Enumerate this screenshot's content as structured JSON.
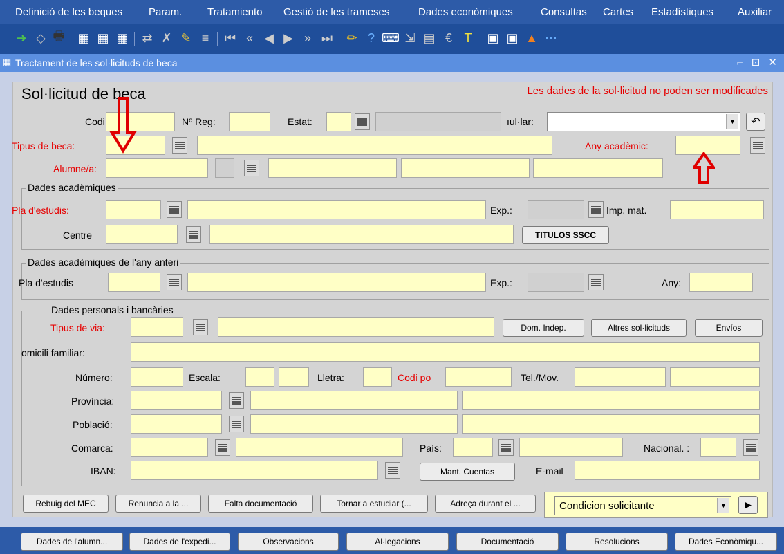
{
  "menu": [
    "Definició de les beques",
    "Param.",
    "Tratamiento",
    "Gestió de les trameses",
    "Dades econòmiques",
    "Consultas",
    "Cartes",
    "Estadístiques",
    "Auxiliar"
  ],
  "toolbar": {
    "icons": [
      "exit-icon",
      "clear-icon",
      "print-icon",
      "query-icon",
      "execute-query-icon",
      "cancel-query-icon",
      "save-icon",
      "delete-icon",
      "new-record-icon",
      "duplicate-icon",
      "first-record-icon",
      "prev-block-icon",
      "prev-record-icon",
      "next-record-icon",
      "next-block-icon",
      "last-record-icon",
      "edit-icon",
      "help-icon",
      "keys-icon",
      "filter-icon",
      "calendar-icon",
      "currency-icon",
      "text-icon",
      "notes-icon",
      "notes2-icon",
      "user-icon",
      "more-icon"
    ]
  },
  "window": {
    "title": "Tractament de les sol·licituds de beca",
    "controls": "⌐ ⊡ ✕"
  },
  "form": {
    "heading": "Sol·licitud de beca",
    "warning": "Les dades de la sol·licitud no poden ser modificades",
    "codi_label": "Codi:",
    "nreg_label": "Nº Reg:",
    "estat_label": "Estat:",
    "titular_label": "ıul·lar:",
    "tipus_beca_label": "Tipus de beca:",
    "any_academic_label": "Any acadèmic:",
    "alumne_label": "Alumne/a:",
    "grp_academiques": "Dades acadèmiques",
    "pla_estudis_label": "Pla d'estudis:",
    "exp_label": "Exp.:",
    "imp_mat_label": "Imp. mat.",
    "centre_label": "Centre",
    "titulos_button": "TITULOS SSCC",
    "grp_anterior": "Dades acadèmiques de l'any anteri",
    "pla_estudis2_label": "Pla d'estudis",
    "exp2_label": "Exp.:",
    "any_label": "Any:",
    "grp_personals": "Dades personals i bancàries",
    "tipus_via_label": "Tipus de via:",
    "dom_indep_button": "Dom. Indep.",
    "altres_button": "Altres sol·licituds",
    "envios_button": "Envíos",
    "domicili_label": "omicili familiar:",
    "numero_label": "Número:",
    "escala_label": "Escala:",
    "lletra_label": "Lletra:",
    "codi_po_label": "Codi po",
    "tel_label": "Tel./Mov.",
    "provincia_label": "Província:",
    "poblacio_label": "Població:",
    "comarca_label": "Comarca:",
    "pais_label": "País:",
    "nacional_label": "Nacional. :",
    "iban_label": "IBAN:",
    "mant_cuentas_button": "Mant. Cuentas",
    "email_label": "E-mail",
    "actions": [
      "Rebuig del MEC",
      "Renuncia a la ...",
      "Falta documentació",
      "Tornar a estudiar (...",
      "Adreça durant el ..."
    ],
    "condicion_value": "Condicion solicitante"
  },
  "bottom_tabs": [
    "Dades de l'alumn...",
    "Dades de l'expedi...",
    "Observacions",
    "Al·legacions",
    "Documentació",
    "Resolucions",
    "Dades Econòmiqu..."
  ],
  "colors": {
    "field": "#ffffc6",
    "required_label": "#e60000",
    "menubar": "#2d5ba8",
    "titlebar": "#5b8fe0"
  }
}
